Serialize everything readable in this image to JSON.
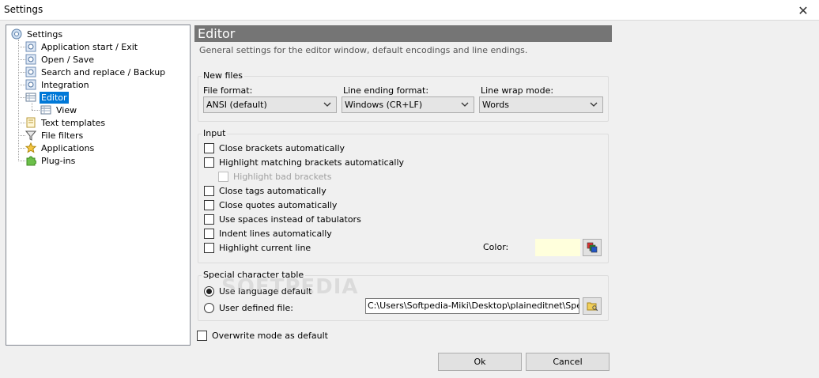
{
  "window": {
    "title": "Settings",
    "close_glyph": "✕"
  },
  "tree": {
    "items": [
      {
        "label": "Settings",
        "icon": "gear-icon"
      },
      {
        "label": "Application start / Exit",
        "icon": "gear-icon"
      },
      {
        "label": "Open / Save",
        "icon": "gear-icon"
      },
      {
        "label": "Search and replace / Backup",
        "icon": "gear-icon"
      },
      {
        "label": "Integration",
        "icon": "gear-icon"
      },
      {
        "label": "Editor",
        "icon": "editor-grid-icon",
        "selected": true
      },
      {
        "label": "View",
        "icon": "editor-grid-icon"
      },
      {
        "label": "Text templates",
        "icon": "document-icon"
      },
      {
        "label": "File filters",
        "icon": "funnel-icon"
      },
      {
        "label": "Applications",
        "icon": "star-icon"
      },
      {
        "label": "Plug-ins",
        "icon": "puzzle-icon"
      }
    ]
  },
  "panel": {
    "header": "Editor",
    "description": "General settings for the editor window, default encodings and line endings."
  },
  "new_files": {
    "title": "New files",
    "file_format_label": "File format:",
    "file_format_value": "ANSI (default)",
    "line_ending_label": "Line ending format:",
    "line_ending_value": "Windows (CR+LF)",
    "line_wrap_label": "Line wrap mode:",
    "line_wrap_value": "Words"
  },
  "input": {
    "title": "Input",
    "options": [
      {
        "label": "Close brackets automatically",
        "checked": false
      },
      {
        "label": "Highlight matching brackets automatically",
        "checked": false
      },
      {
        "label": "Highlight bad brackets",
        "checked": false,
        "disabled": true
      },
      {
        "label": "Close tags automatically",
        "checked": false
      },
      {
        "label": "Close quotes automatically",
        "checked": false
      },
      {
        "label": "Use spaces instead of tabulators",
        "checked": false
      },
      {
        "label": "Indent lines automatically",
        "checked": false
      },
      {
        "label": "Highlight current line",
        "checked": false
      }
    ],
    "color_label": "Color:",
    "color_value": "#ffffdc"
  },
  "special": {
    "title": "Special character table",
    "use_default_label": "Use language default",
    "user_defined_label": "User defined file:",
    "file_path": "C:\\Users\\Softpedia-Miki\\Desktop\\plaineditnet\\SpecialCh",
    "selected": "use_default"
  },
  "overwrite_label": "Overwrite mode as default",
  "buttons": {
    "ok": "Ok",
    "cancel": "Cancel"
  },
  "watermark": "SOFTPEDIA"
}
